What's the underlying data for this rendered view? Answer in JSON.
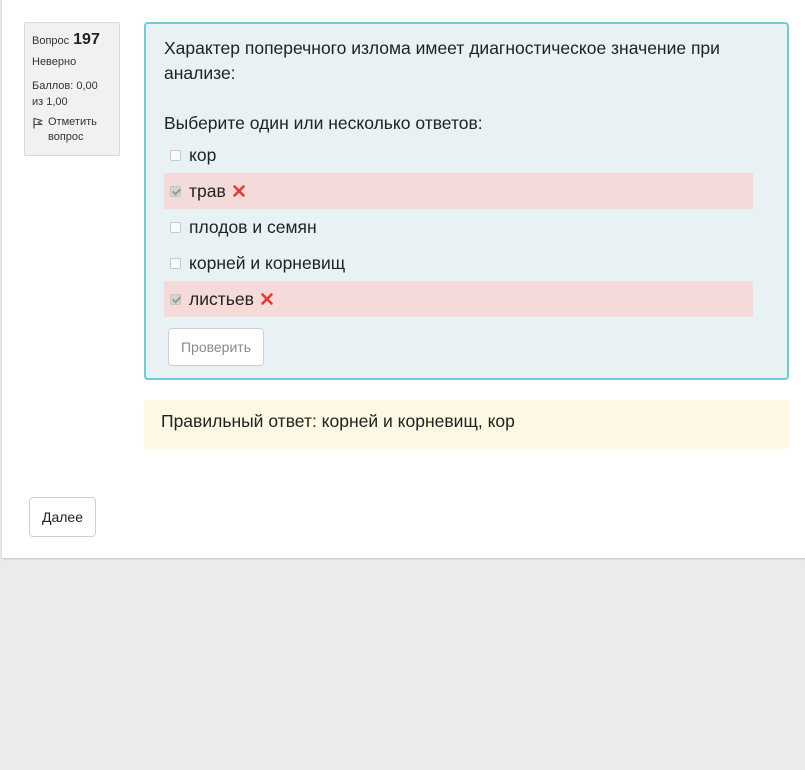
{
  "question_info": {
    "label": "Вопрос",
    "number": "197",
    "state": "Неверно",
    "grade": "Баллов: 0,00 из 1,00",
    "flag_label": "Отметить вопрос"
  },
  "question": {
    "text": "Характер поперечного излома имеет диагностическое значение при анализе:",
    "prompt": "Выберите один или несколько ответов:",
    "options": [
      {
        "label": "кор",
        "checked": false,
        "status": "none"
      },
      {
        "label": "трав",
        "checked": true,
        "status": "incorrect"
      },
      {
        "label": "плодов и семян",
        "checked": false,
        "status": "none"
      },
      {
        "label": "корней и корневищ",
        "checked": false,
        "status": "none"
      },
      {
        "label": "листьев",
        "checked": true,
        "status": "incorrect"
      }
    ],
    "check_button": "Проверить"
  },
  "feedback": {
    "correct_answer": "Правильный ответ: корней и корневищ, кор"
  },
  "navigation": {
    "next_button": "Далее"
  },
  "colors": {
    "question_bg": "#e8f2f5",
    "question_border": "#6fcbd6",
    "incorrect_bg": "#f5dada",
    "feedback_bg": "#fcf8e3",
    "incorrect_icon": "#e53935"
  },
  "icons": {
    "flag": "flag-icon",
    "incorrect": "incorrect-x-icon"
  }
}
